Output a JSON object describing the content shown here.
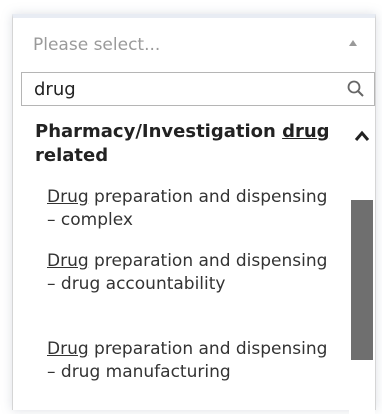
{
  "select": {
    "placeholder": "Please select..."
  },
  "search": {
    "value": "drug"
  },
  "results": {
    "group": {
      "label_before": "Pharmacy/Investigation ",
      "label_match": "drug",
      "label_after": " related"
    },
    "options": [
      {
        "match": "Drug",
        "rest": " preparation and dispensing – complex"
      },
      {
        "match": "Drug",
        "rest": " preparation and dispensing – drug accountability"
      },
      {
        "match": "Drug",
        "rest": " preparation and dispensing – drug manufacturing"
      }
    ]
  },
  "icons": {
    "search": "search-icon",
    "select_arrow": "caret-up-icon",
    "scroll_up": "chevron-up-icon"
  }
}
